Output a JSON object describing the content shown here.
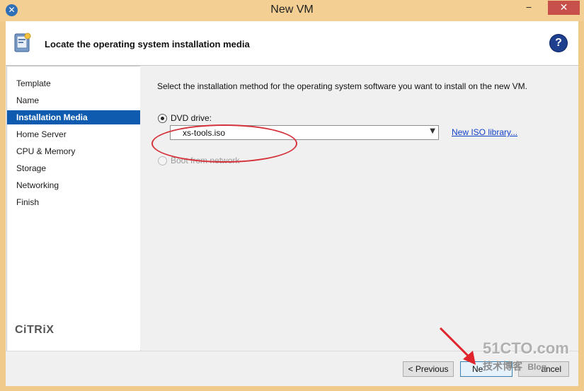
{
  "window": {
    "title": "New VM",
    "minimize": "‒",
    "maximize": "□",
    "close": "✕"
  },
  "header": {
    "title": "Locate the operating system installation media",
    "help": "?"
  },
  "nav": {
    "items": [
      {
        "label": "Template"
      },
      {
        "label": "Name"
      },
      {
        "label": "Installation Media",
        "active": true
      },
      {
        "label": "Home Server"
      },
      {
        "label": "CPU & Memory"
      },
      {
        "label": "Storage"
      },
      {
        "label": "Networking"
      },
      {
        "label": "Finish"
      }
    ],
    "brand": "CiTRiX"
  },
  "content": {
    "instruction": "Select the installation method for the operating system software you want to install on the new VM.",
    "dvd": {
      "label": "DVD drive:",
      "selected": true
    },
    "iso": {
      "value": "xs-tools.iso"
    },
    "new_iso_link": "New ISO library...",
    "network": {
      "label": "Boot from network",
      "enabled": false
    }
  },
  "footer": {
    "previous": "< Previous",
    "next": "Ne",
    "cancel": "ancel"
  },
  "watermark": {
    "line1": "51CTO.com",
    "line2": "技术博客",
    "line3": "Blog"
  },
  "colors": {
    "accent": "#0f5bb0",
    "annotation": "#d5333c",
    "title_bar": "#f3cf93"
  }
}
